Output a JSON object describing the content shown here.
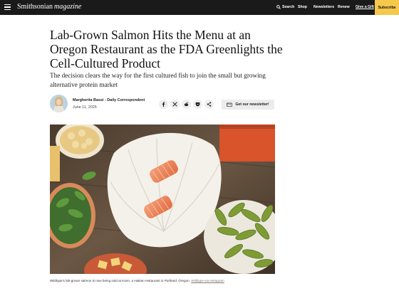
{
  "nav": {
    "logo_brand": "Smithsonian",
    "logo_suffix": "magazine",
    "search_label": "Search",
    "shop_label": "Shop",
    "newsletters_label": "Newsletters",
    "renew_label": "Renew",
    "gift_label": "Give a Gift",
    "subscribe_label": "Subscribe"
  },
  "article": {
    "headline": "Lab-Grown Salmon Hits the Menu at an Oregon Restaurant as the FDA Greenlights the Cell-Cultured Product",
    "dek": "The decision clears the way for the first cultured fish to join the small but growing alternative protein market",
    "author": "Margherita Bassi - Daily Correspondent",
    "date": "June 11, 2025",
    "newsletter_label": "Get our newsletter!",
    "caption": "Wildtype's lab-grown salmon is now being sold at Kann, a Haitian restaurant in Portland, Oregon.",
    "caption_credit": "Wildtype via Instagram"
  },
  "share_icons": [
    "facebook-icon",
    "x-icon",
    "reddit-icon",
    "pocket-icon",
    "share-icon"
  ],
  "colors": {
    "topbar": "#1a1a1a",
    "subscribe": "#f5c84b",
    "newsletter_bg": "#ececec"
  }
}
